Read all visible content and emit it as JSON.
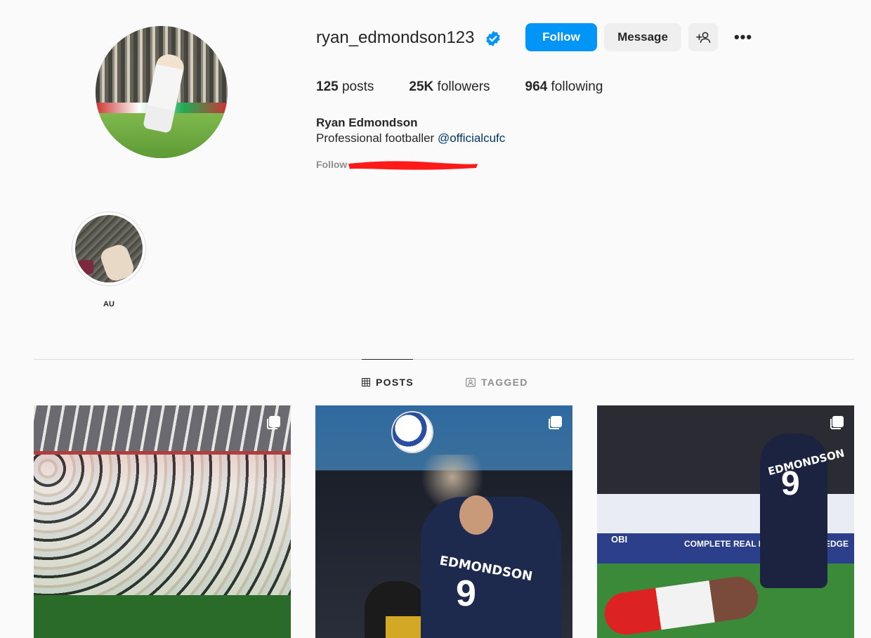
{
  "profile": {
    "username": "ryan_edmondson123",
    "verified_icon": "verified-badge-icon",
    "full_name": "Ryan Edmondson",
    "bio_text": "Professional footballer ",
    "bio_mention": "@officialcufc",
    "followed_by_prefix": "Follow",
    "stats": {
      "posts_count": "125",
      "posts_label": " posts",
      "followers_count": "25K",
      "followers_label": " followers",
      "following_count": "964",
      "following_label": " following"
    }
  },
  "actions": {
    "follow_label": "Follow",
    "message_label": "Message",
    "add_user_icon": "add-user-icon",
    "more_icon": "more-options-icon",
    "more_label": "•••"
  },
  "highlights": [
    {
      "label": "AU"
    }
  ],
  "tabs": {
    "posts_label": "POSTS",
    "tagged_label": "TAGGED",
    "active": "POSTS"
  },
  "posts": {
    "post2": {
      "ball_hint": "",
      "name": "EDMONDSON",
      "number": "9"
    },
    "post3": {
      "name": "EDMONDSON",
      "number": "9",
      "ad_text_1": "OBI",
      "ad_text_2": "COMPLETE REAL ESTATE KNOWLEDGE"
    }
  },
  "colors": {
    "accent": "#0095f6",
    "verified": "#0095f6",
    "redaction": "#ff0000"
  }
}
